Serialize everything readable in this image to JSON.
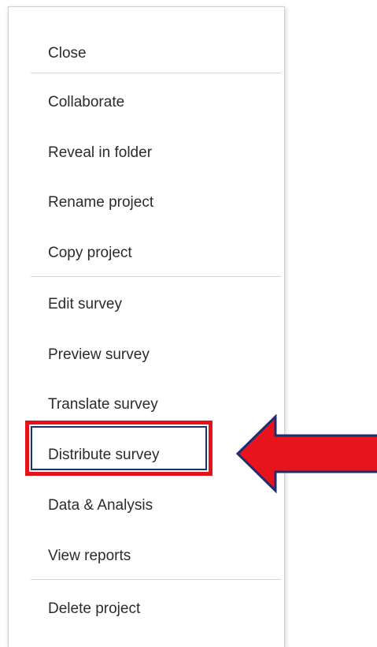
{
  "menu": {
    "items": [
      {
        "label": "Close"
      },
      {
        "label": "Collaborate"
      },
      {
        "label": "Reveal in folder"
      },
      {
        "label": "Rename project"
      },
      {
        "label": "Copy project"
      },
      {
        "label": "Edit survey"
      },
      {
        "label": "Preview survey"
      },
      {
        "label": "Translate survey"
      },
      {
        "label": "Distribute survey"
      },
      {
        "label": "Data & Analysis"
      },
      {
        "label": "View reports"
      },
      {
        "label": "Delete project"
      }
    ],
    "highlighted_item": "Distribute survey"
  },
  "annotation": {
    "icon": "arrow-left-icon",
    "fill_color": "#e8141c",
    "outline_color": "#1c2f6e",
    "box_color": "#e3121b"
  }
}
